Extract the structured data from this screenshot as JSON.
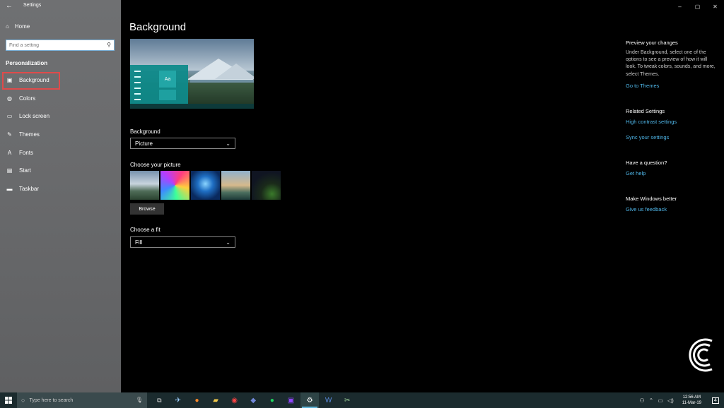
{
  "window": {
    "app_title": "Settings",
    "minimize": "–",
    "maximize": "▢",
    "close": "✕"
  },
  "sidebar": {
    "home_label": "Home",
    "search_placeholder": "Find a setting",
    "section_label": "Personalization",
    "items": [
      {
        "label": "Background",
        "icon": "picture-icon",
        "active": true
      },
      {
        "label": "Colors",
        "icon": "palette-icon"
      },
      {
        "label": "Lock screen",
        "icon": "lock-screen-icon"
      },
      {
        "label": "Themes",
        "icon": "brush-icon"
      },
      {
        "label": "Fonts",
        "icon": "font-icon"
      },
      {
        "label": "Start",
        "icon": "start-icon"
      },
      {
        "label": "Taskbar",
        "icon": "taskbar-icon"
      }
    ]
  },
  "main": {
    "title": "Background",
    "preview_tile_text": "Aa",
    "background_label": "Background",
    "background_value": "Picture",
    "choose_picture_label": "Choose your picture",
    "browse_label": "Browse",
    "choose_fit_label": "Choose a fit",
    "fit_value": "Fill"
  },
  "right": {
    "preview_heading": "Preview your changes",
    "preview_text": "Under Background, select one of the options to see a preview of how it will look. To tweak colors, sounds, and more, select Themes.",
    "go_to_themes": "Go to Themes",
    "related_heading": "Related Settings",
    "high_contrast": "High contrast settings",
    "sync_settings": "Sync your settings",
    "question_heading": "Have a question?",
    "get_help": "Get help",
    "better_heading": "Make Windows better",
    "feedback": "Give us feedback"
  },
  "taskbar": {
    "search_placeholder": "Type here to search",
    "time": "12:56 AM",
    "date": "11-Mar-19",
    "notification_count": "4"
  },
  "colors": {
    "accent": "#4fb6e8",
    "highlight_border": "#e04b4b",
    "taskbar": "#1b2b2e"
  }
}
